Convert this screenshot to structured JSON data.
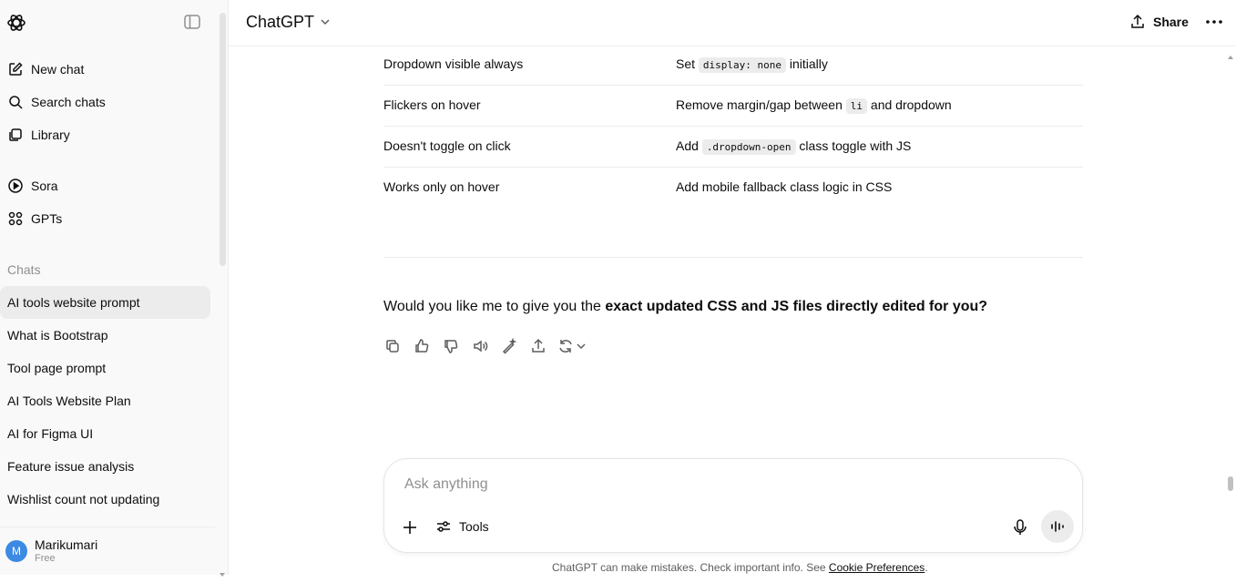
{
  "sidebar": {
    "nav": [
      {
        "label": "New chat",
        "icon": "new-chat-icon"
      },
      {
        "label": "Search chats",
        "icon": "search-icon"
      },
      {
        "label": "Library",
        "icon": "library-icon"
      },
      {
        "label": "Sora",
        "icon": "play-circle-icon"
      },
      {
        "label": "GPTs",
        "icon": "grid-icon"
      }
    ],
    "section_label": "Chats",
    "chats": [
      "AI tools website prompt",
      "What is Bootstrap",
      "Tool page prompt",
      "AI Tools Website Plan",
      "AI for Figma UI",
      "Feature issue analysis",
      "Wishlist count not updating"
    ],
    "active_chat_index": 0,
    "user": {
      "initial": "M",
      "name": "Marikumari",
      "plan": "Free"
    }
  },
  "header": {
    "model": "ChatGPT",
    "share_label": "Share"
  },
  "table": {
    "rows": [
      {
        "problem": "Dropdown visible always",
        "fix_pre": "Set ",
        "fix_code": "display: none",
        "fix_post": " initially"
      },
      {
        "problem": "Flickers on hover",
        "fix_pre": "Remove margin/gap between ",
        "fix_code": "li",
        "fix_post": " and dropdown"
      },
      {
        "problem": "Doesn't toggle on click",
        "fix_pre": "Add ",
        "fix_code": ".dropdown-open",
        "fix_post": " class toggle with JS"
      },
      {
        "problem": "Works only on hover",
        "fix_pre": "Add mobile fallback class logic in CSS",
        "fix_code": "",
        "fix_post": ""
      }
    ]
  },
  "message": {
    "question_pre": "Would you like me to give you the ",
    "question_bold": "exact updated CSS and JS files directly edited for you?"
  },
  "composer": {
    "placeholder": "Ask anything",
    "tools_label": "Tools"
  },
  "footer": {
    "text": "ChatGPT can make mistakes. Check important info. See ",
    "link": "Cookie Preferences",
    "end": "."
  }
}
